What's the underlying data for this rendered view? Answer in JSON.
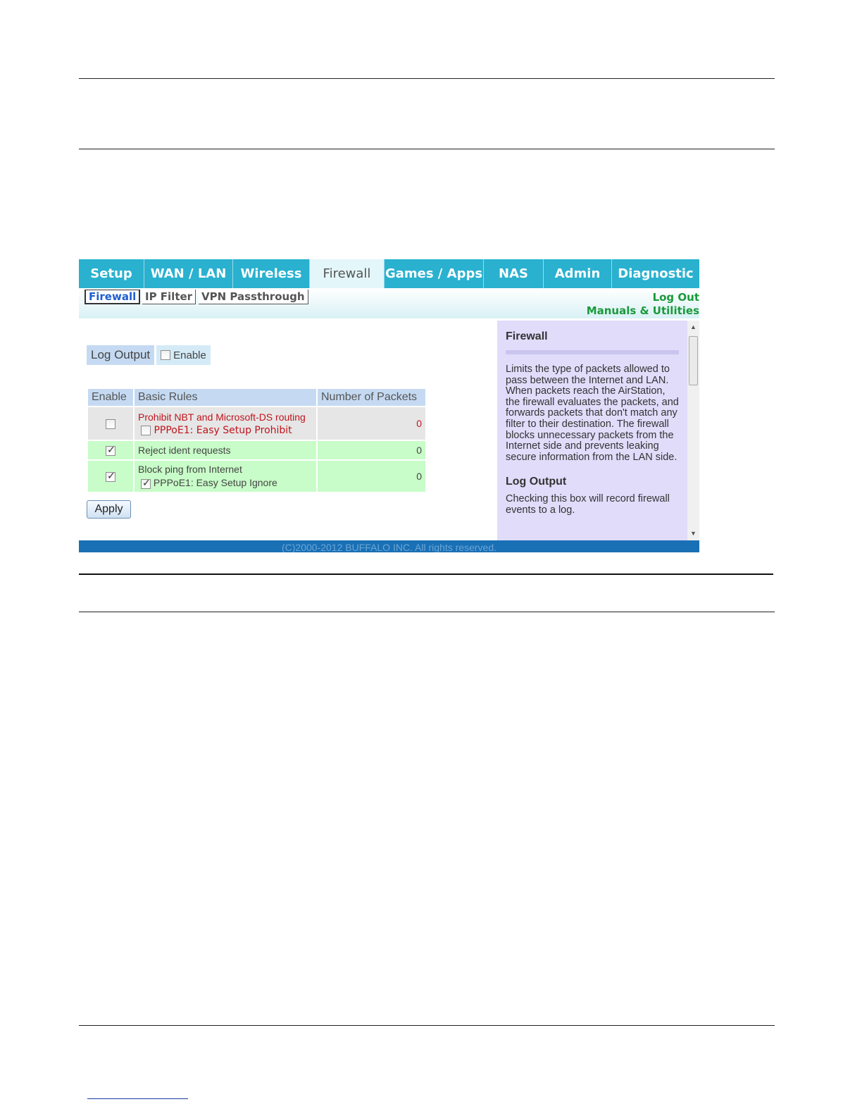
{
  "nav": {
    "tabs": [
      "Setup",
      "WAN / LAN",
      "Wireless",
      "Firewall",
      "Games / Apps",
      "NAS",
      "Admin",
      "Diagnostic"
    ],
    "active_tab": "Firewall"
  },
  "subnav": {
    "tabs": [
      "Firewall",
      "IP Filter",
      "VPN Passthrough"
    ],
    "active": "Firewall",
    "logout": "Log Out",
    "manuals": "Manuals & Utilities"
  },
  "log_output": {
    "label": "Log Output",
    "enable_label": "Enable",
    "checked": false
  },
  "rules_table": {
    "headers": [
      "Enable",
      "Basic Rules",
      "Number of Packets"
    ],
    "rows": [
      {
        "enabled": false,
        "rule": "Prohibit NBT and Microsoft-DS routing",
        "sub_label": "PPPoE1: Easy Setup Prohibit",
        "sub_checked": false,
        "packets": "0"
      },
      {
        "enabled": true,
        "rule": "Reject ident requests",
        "packets": "0"
      },
      {
        "enabled": true,
        "rule": "Block ping from Internet",
        "sub_label": "PPPoE1: Easy Setup Ignore",
        "sub_checked": true,
        "packets": "0"
      }
    ]
  },
  "apply_label": "Apply",
  "help": {
    "title": "Firewall",
    "body": "Limits the type of packets allowed to pass between the Internet and LAN. When packets reach the AirStation, the firewall evaluates the packets, and forwards packets that don't match any filter to their destination. The firewall blocks unnecessary packets from the Internet side and prevents leaking secure information from the LAN side.",
    "log_title": "Log Output",
    "log_body": "Checking this box will record firewall events to a log."
  },
  "footer": "(C)2000-2012 BUFFALO INC. All rights reserved.",
  "colors": {
    "nav_bg": "#29b1cf",
    "help_bg": "#e0dcfa",
    "row_green": "#c8fcc8",
    "alert_red": "#c0141c",
    "link_green": "#1a9a3b",
    "footer_bg": "#1a70b5"
  }
}
